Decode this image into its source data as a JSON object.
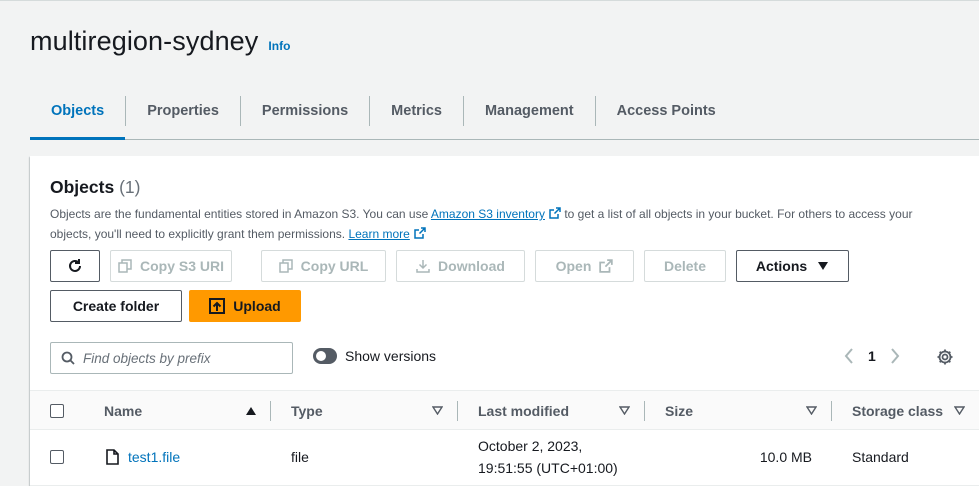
{
  "page": {
    "title": "multiregion-sydney",
    "info_label": "Info"
  },
  "tabs": [
    {
      "label": "Objects",
      "active": true
    },
    {
      "label": "Properties",
      "active": false
    },
    {
      "label": "Permissions",
      "active": false
    },
    {
      "label": "Metrics",
      "active": false
    },
    {
      "label": "Management",
      "active": false
    },
    {
      "label": "Access Points",
      "active": false
    }
  ],
  "objects_panel": {
    "title": "Objects",
    "count": "(1)",
    "description_part1": "Objects are the fundamental entities stored in Amazon S3. You can use ",
    "inventory_link": "Amazon S3 inventory",
    "description_part2": " to get a list of all objects in your bucket. For others to access your objects, you'll need to explicitly grant them permissions. ",
    "learn_more_link": "Learn more"
  },
  "toolbar": {
    "copy_s3_uri": "Copy S3 URI",
    "copy_url": "Copy URL",
    "download": "Download",
    "open": "Open",
    "delete": "Delete",
    "actions": "Actions",
    "create_folder": "Create folder",
    "upload": "Upload"
  },
  "search": {
    "placeholder": "Find objects by prefix"
  },
  "show_versions": {
    "label": "Show versions",
    "enabled": false
  },
  "pagination": {
    "current_page": "1"
  },
  "table": {
    "columns": {
      "name": "Name",
      "type": "Type",
      "last_modified": "Last modified",
      "size": "Size",
      "storage_class": "Storage class"
    },
    "rows": [
      {
        "name": "test1.file",
        "type": "file",
        "last_modified_line1": "October 2, 2023,",
        "last_modified_line2": "19:51:55 (UTC+01:00)",
        "size": "10.0 MB",
        "storage_class": "Standard"
      }
    ]
  },
  "colors": {
    "accent": "#0073bb",
    "primary_button": "#ec7211",
    "background": "#f2f3f3"
  }
}
